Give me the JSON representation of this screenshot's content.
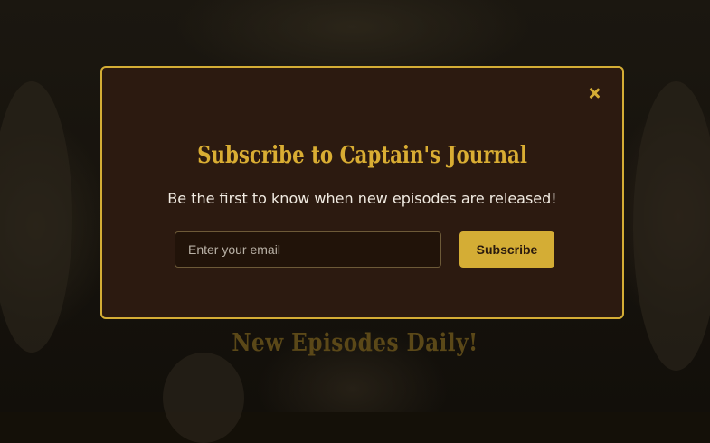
{
  "background": {
    "headline": "New Episodes Daily!"
  },
  "modal": {
    "close_icon": "close-icon",
    "title": "Subscribe to Captain's Journal",
    "subtitle": "Be the first to know when new episodes are released!",
    "email_placeholder": "Enter your email",
    "email_value": "",
    "subscribe_label": "Subscribe",
    "accent_color": "#d4ad35",
    "background_color": "#2c1a10"
  }
}
